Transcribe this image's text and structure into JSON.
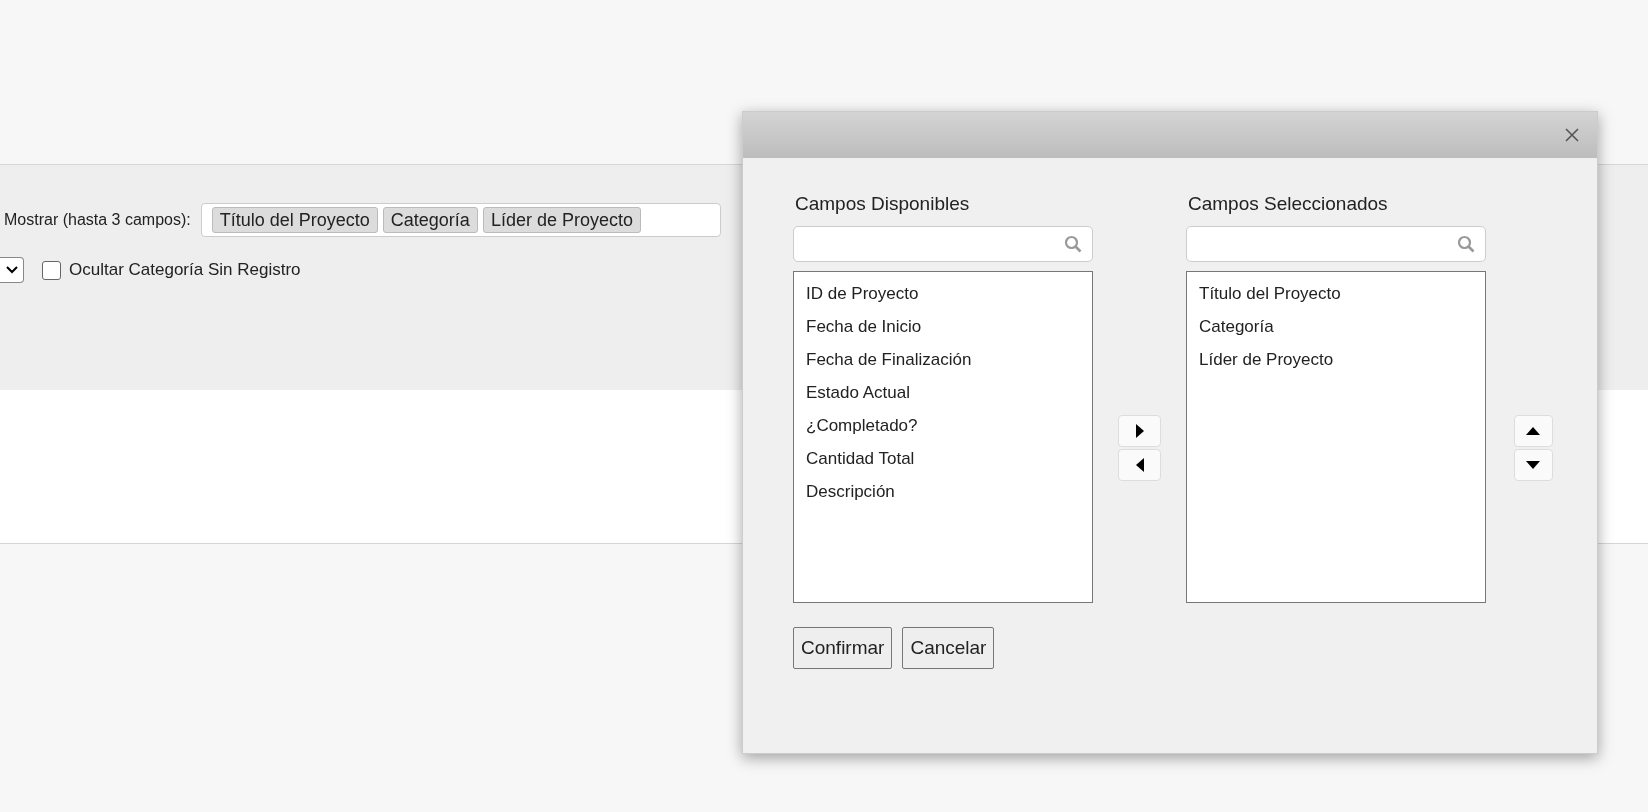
{
  "filter_bar": {
    "display_label": "Mostrar (hasta 3 campos):",
    "display_tags": [
      "Título del Proyecto",
      "Categoría",
      "Líder de Proyecto"
    ],
    "hide_empty": {
      "label": "Ocultar Categoría Sin Registro",
      "checked": false
    }
  },
  "dialog": {
    "available": {
      "title": "Campos Disponibles",
      "items": [
        "ID de Proyecto",
        "Fecha de Inicio",
        "Fecha de Finalización",
        "Estado Actual",
        "¿Completado?",
        "Cantidad Total",
        "Descripción"
      ]
    },
    "selected": {
      "title": "Campos Seleccionados",
      "items": [
        "Título del Proyecto",
        "Categoría",
        "Líder de Proyecto"
      ]
    },
    "buttons": [
      "Confirmar",
      "Cancelar"
    ]
  }
}
